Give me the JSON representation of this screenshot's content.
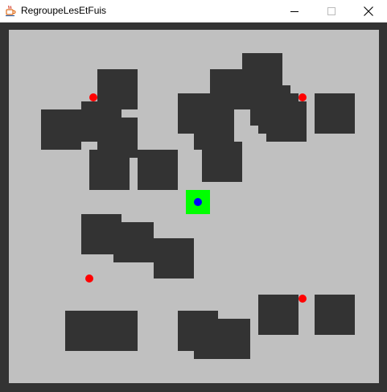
{
  "window": {
    "title": "RegroupeLesEtFuis",
    "app_icon": "java-icon",
    "controls": [
      "minimize-icon",
      "maximize-icon",
      "close-icon"
    ]
  },
  "colors": {
    "frame": "#333333",
    "board": "#c0c0c0",
    "wall": "#333333",
    "start_tile": "#00ff00",
    "player": "#0000ff",
    "fruit": "#ff0000"
  }
}
